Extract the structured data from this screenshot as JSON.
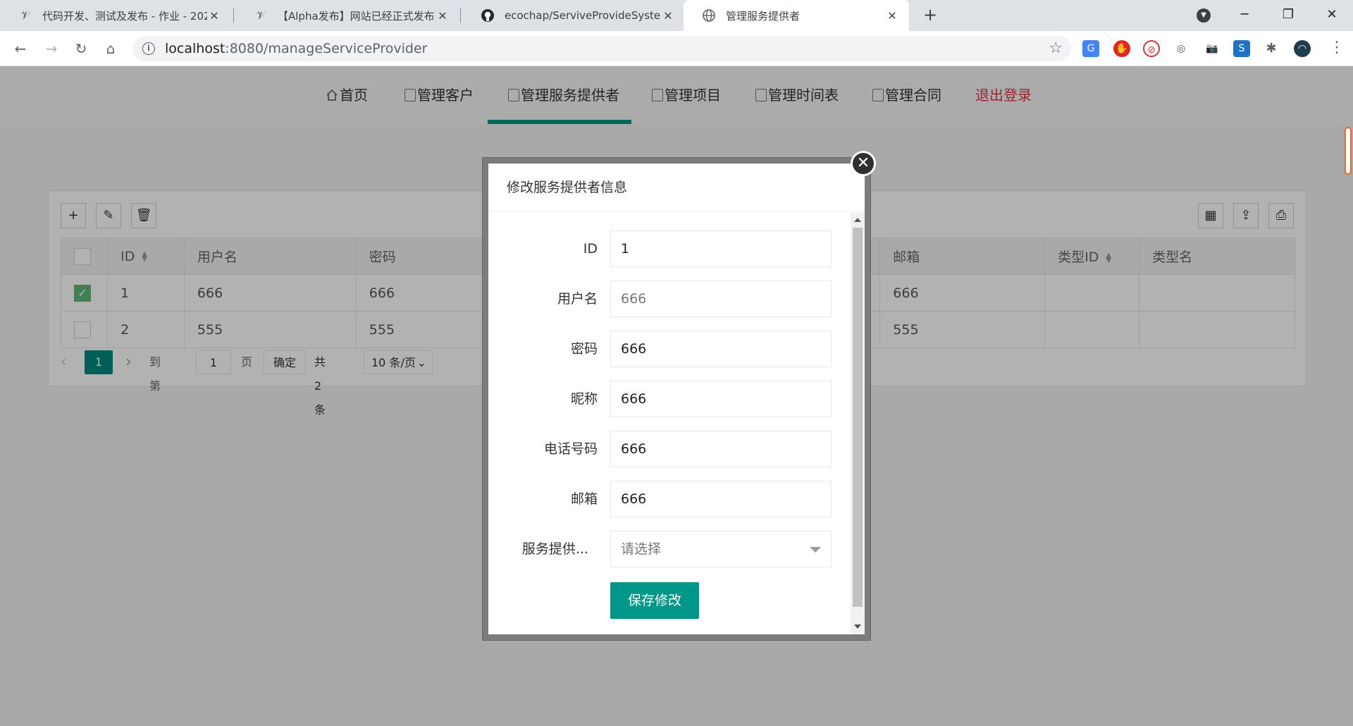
{
  "browser": {
    "tabs": [
      {
        "title": "代码开发、测试及发布 - 作业 - 202",
        "icon": "cnblogs-icon"
      },
      {
        "title": "【Alpha发布】网站已经正式发布!",
        "icon": "cnblogs-icon"
      },
      {
        "title": "ecochap/ServiveProvideSystem",
        "icon": "github-icon"
      },
      {
        "title": "管理服务提供者",
        "icon": "globe-icon"
      }
    ],
    "url_host": "localhost",
    "url_path": ":8080/manageServiceProvider"
  },
  "nav": {
    "items": [
      {
        "label": "首页"
      },
      {
        "label": "管理客户"
      },
      {
        "label": "管理服务提供者"
      },
      {
        "label": "管理项目"
      },
      {
        "label": "管理时间表"
      },
      {
        "label": "管理合同"
      }
    ],
    "logout": "退出登录"
  },
  "table": {
    "columns": [
      "ID",
      "用户名",
      "密码",
      "邮箱",
      "类型ID",
      "类型名"
    ],
    "rows": [
      {
        "checked": true,
        "id": "1",
        "username": "666",
        "password": "666",
        "email": "666",
        "type_id": "",
        "type_name": ""
      },
      {
        "checked": false,
        "id": "2",
        "username": "555",
        "password": "555",
        "email": "555",
        "type_id": "",
        "type_name": ""
      }
    ]
  },
  "pager": {
    "current": "1",
    "goto_label": "到第",
    "goto_value": "1",
    "page_unit": "页",
    "confirm": "确定",
    "total": "共 2 条",
    "page_size": "10 条/页"
  },
  "modal": {
    "title": "修改服务提供者信息",
    "fields": [
      {
        "label": "ID",
        "value": "1"
      },
      {
        "label": "用户名",
        "value": "666"
      },
      {
        "label": "密码",
        "value": "666"
      },
      {
        "label": "昵称",
        "value": "666"
      },
      {
        "label": "电话号码",
        "value": "666"
      },
      {
        "label": "邮箱",
        "value": "666"
      }
    ],
    "select_label": "服务提供...",
    "select_placeholder": "请选择",
    "save_label": "保存修改",
    "close_symbol": "✕"
  },
  "colors": {
    "accent": "#009688",
    "checked": "#5fb878",
    "logout": "#e2363e"
  }
}
